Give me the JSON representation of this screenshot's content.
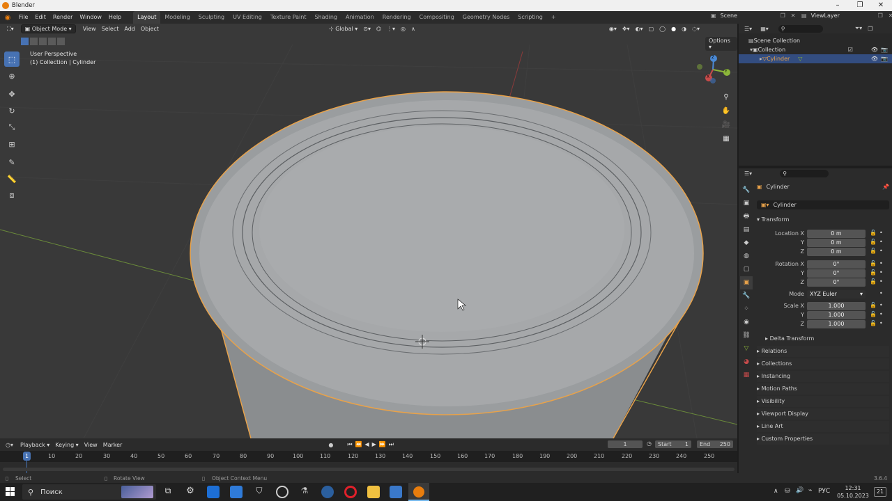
{
  "title_bar": {
    "title": "Blender"
  },
  "menu": {
    "items": [
      "File",
      "Edit",
      "Render",
      "Window",
      "Help"
    ],
    "workspaces": [
      "Layout",
      "Modeling",
      "Sculpting",
      "UV Editing",
      "Texture Paint",
      "Shading",
      "Animation",
      "Rendering",
      "Compositing",
      "Geometry Nodes",
      "Scripting"
    ],
    "add_tab": "+",
    "scene_label": "Scene",
    "viewlayer_label": "ViewLayer"
  },
  "viewport": {
    "mode": "Object Mode",
    "menus": [
      "View",
      "Select",
      "Add",
      "Object"
    ],
    "transform_orientation": "Global",
    "options_label": "Options",
    "perspective_label": "User Perspective",
    "collection_label": "(1) Collection | Cylinder",
    "gizmo_axes": [
      "X",
      "Y",
      "Z"
    ]
  },
  "outliner": {
    "items": [
      {
        "label": "Scene Collection"
      },
      {
        "label": "Collection"
      },
      {
        "label": "Cylinder"
      }
    ]
  },
  "properties": {
    "object_name": "Cylinder",
    "data_name": "Cylinder",
    "transform_header": "Transform",
    "location_label": "Location X",
    "location": [
      "0 m",
      "0 m",
      "0 m"
    ],
    "rotation_label": "Rotation X",
    "rotation": [
      "0°",
      "0°",
      "0°"
    ],
    "mode_label": "Mode",
    "mode_value": "XYZ Euler",
    "scale_label": "Scale X",
    "scale": [
      "1.000",
      "1.000",
      "1.000"
    ],
    "axis_y": "Y",
    "axis_z": "Z",
    "delta_transform": "Delta Transform",
    "panels": [
      "Relations",
      "Collections",
      "Instancing",
      "Motion Paths",
      "Visibility",
      "Viewport Display",
      "Line Art",
      "Custom Properties"
    ]
  },
  "timeline": {
    "menus": [
      "Playback",
      "Keying",
      "View",
      "Marker"
    ],
    "current_frame": "1",
    "start_label": "Start",
    "start": "1",
    "end_label": "End",
    "end": "250",
    "ruler": [
      "1",
      "10",
      "20",
      "30",
      "40",
      "50",
      "60",
      "70",
      "80",
      "90",
      "100",
      "110",
      "120",
      "130",
      "140",
      "150",
      "160",
      "170",
      "180",
      "190",
      "200",
      "210",
      "220",
      "230",
      "240",
      "250"
    ]
  },
  "status_bar": {
    "select": "Select",
    "rotate_view": "Rotate View",
    "context_menu": "Object Context Menu",
    "version": "3.6.4"
  },
  "taskbar": {
    "search_placeholder": "Поиск",
    "language": "РУС",
    "time": "12:31",
    "date": "05.10.2023",
    "notifications": "21"
  },
  "colors": {
    "selection_orange": "#e8a24a",
    "active_blue": "#4772b3",
    "x_axis": "#c74b4b",
    "y_axis": "#8bb53a",
    "z_axis": "#4b8ad6"
  }
}
